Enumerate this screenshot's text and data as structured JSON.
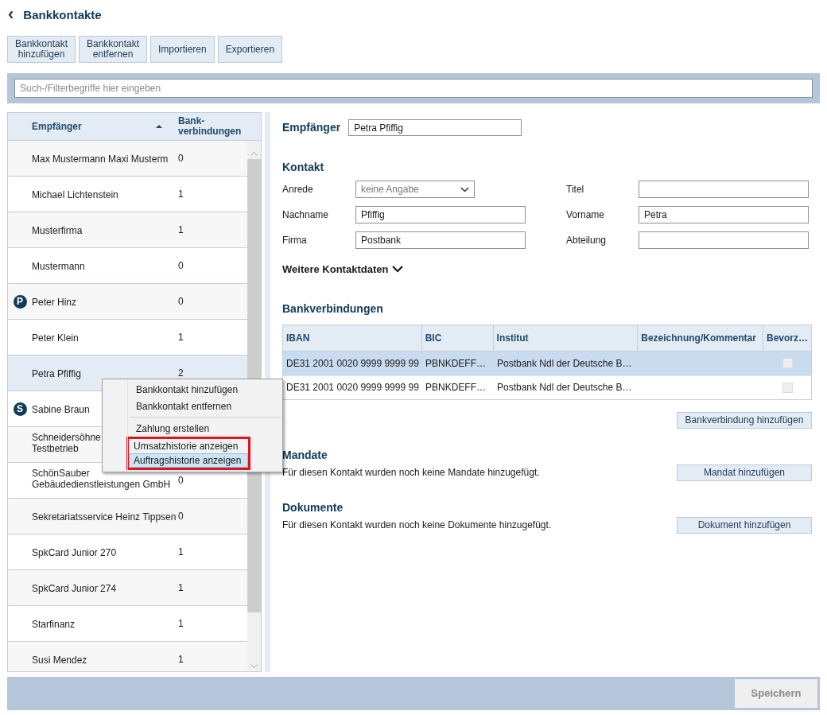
{
  "header": {
    "back_glyph": "‹",
    "title": "Bankkontakte"
  },
  "toolbar": [
    "Bankkontakt hinzufügen",
    "Bankkontakt entfernen",
    "Importieren",
    "Exportieren"
  ],
  "search": {
    "placeholder": "Such-/Filterbegriffe hier eingeben"
  },
  "contact_list": {
    "columns": [
      {
        "label": "Empfänger",
        "sorted": true
      },
      {
        "label": "Bank-verbindungen",
        "sorted": false
      }
    ],
    "rows": [
      {
        "name": "Max Mustermann Maxi Musterm",
        "count": "0",
        "selected": false
      },
      {
        "name": "Michael Lichtenstein",
        "count": "1",
        "selected": false
      },
      {
        "name": "Musterfirma",
        "count": "1",
        "selected": false
      },
      {
        "name": "Mustermann",
        "count": "0",
        "selected": false
      },
      {
        "name": "Peter Hinz",
        "count": "0",
        "selected": false,
        "badge": "P"
      },
      {
        "name": "Peter Klein",
        "count": "1",
        "selected": false
      },
      {
        "name": "Petra Pfiffig",
        "count": "2",
        "selected": true
      },
      {
        "name": "Sabine Braun",
        "selected": false,
        "badge": "S"
      },
      {
        "name": "Schneidersöhne\nTestbetrieb",
        "selected": false
      },
      {
        "name": "SchönSauber Gebäudedienstleistungen GmbH",
        "count": "0",
        "selected": false
      },
      {
        "name": "Sekretariatsservice Heinz Tippsen",
        "count": "0",
        "selected": false
      },
      {
        "name": "SpkCard Junior 270",
        "count": "1",
        "selected": false
      },
      {
        "name": "SpkCard Junior 274",
        "count": "1",
        "selected": false
      },
      {
        "name": "Starfinanz",
        "count": "1",
        "selected": false
      },
      {
        "name": "Susi Mendez",
        "count": "1",
        "selected": false
      }
    ]
  },
  "context_menu": {
    "items": [
      {
        "kind": "item",
        "label": "Bankkontakt hinzufügen",
        "selected": false
      },
      {
        "kind": "item",
        "label": "Bankkontakt entfernen",
        "selected": false
      },
      {
        "kind": "separator"
      },
      {
        "kind": "item",
        "label": "Zahlung erstellen",
        "selected": false
      },
      {
        "kind": "item",
        "label": "Umsatzhistorie anzeigen",
        "selected": false,
        "marked": true
      },
      {
        "kind": "item",
        "label": "Auftragshistorie anzeigen",
        "selected": true,
        "marked": true
      }
    ]
  },
  "detail": {
    "recipient": {
      "label": "Empfänger",
      "value": "Petra Pfiffig"
    },
    "contact": {
      "heading": "Kontakt",
      "fields": [
        {
          "label": "Anrede",
          "kind": "select",
          "value": "keine Angabe"
        },
        {
          "label": "Titel",
          "kind": "text"
        },
        {
          "label": "Nachname",
          "kind": "text",
          "value": "Pfiffig"
        },
        {
          "label": "Vorname",
          "kind": "text",
          "value": "Petra"
        },
        {
          "label": "Firma",
          "kind": "text",
          "value": "Postbank"
        },
        {
          "label": "Abteilung",
          "kind": "text"
        }
      ],
      "more": {
        "label": "Weitere Kontaktdaten",
        "expanded": false
      }
    },
    "bank": {
      "heading": "Bankverbindungen",
      "columns": [
        "IBAN",
        "BIC",
        "Institut",
        "Bezeichnung/Kommentar",
        "Bevorz…"
      ],
      "rows": [
        {
          "iban": "DE31 2001 0020 9999 9999 99",
          "bic": "PBNKDEFF…",
          "institut": "Postbank Ndl der Deutsche B…",
          "preferred": false,
          "selected": true
        },
        {
          "iban": "DE31 2001 0020 9999 9999 99",
          "bic": "PBNKDEFF…",
          "institut": "Postbank Ndl der Deutsche B…",
          "preferred": false,
          "selected": false
        }
      ],
      "button": "Bankverbindung hinzufügen"
    },
    "mandates": {
      "heading": "Mandate",
      "text": "Für diesen Kontakt wurden noch keine Mandate hinzugefügt.",
      "button": "Mandat hinzufügen"
    },
    "documents": {
      "heading": "Dokumente",
      "text": "Für diesen Kontakt wurden noch keine Dokumente hinzugefügt.",
      "button": "Dokument hinzufügen"
    }
  },
  "footer": {
    "save_button": {
      "label": "Speichern",
      "disabled": true
    }
  }
}
